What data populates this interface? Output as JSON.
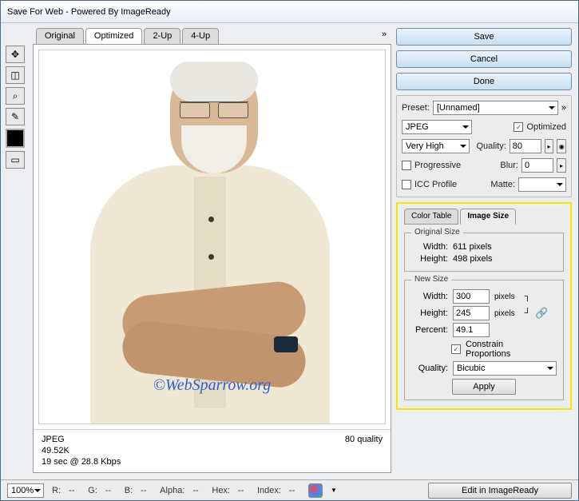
{
  "window": {
    "title": "Save For Web - Powered By ImageReady"
  },
  "tabs": {
    "original": "Original",
    "optimized": "Optimized",
    "two_up": "2-Up",
    "four_up": "4-Up"
  },
  "tools": {
    "hand": "✋",
    "slice": "✂",
    "zoom": "🔍",
    "eyedrop": "💧",
    "toggle": "⇆"
  },
  "info": {
    "format": "JPEG",
    "size": "49.52K",
    "speed": "19 sec @ 28.8 Kbps",
    "quality": "80 quality"
  },
  "watermark": "©WebSparrow.org",
  "buttons": {
    "save": "Save",
    "cancel": "Cancel",
    "done": "Done",
    "apply": "Apply",
    "edit": "Edit in ImageReady"
  },
  "settings": {
    "preset_label": "Preset:",
    "preset_value": "[Unnamed]",
    "format": "JPEG",
    "optimized_label": "Optimized",
    "optimized": "✓",
    "quality_preset": "Very High",
    "quality_label": "Quality:",
    "quality_value": "80",
    "progressive_label": "Progressive",
    "blur_label": "Blur:",
    "blur_value": "0",
    "icc_label": "ICC Profile",
    "matte_label": "Matte:"
  },
  "image_tabs": {
    "color_table": "Color Table",
    "image_size": "Image Size"
  },
  "original_size": {
    "legend": "Original Size",
    "width_label": "Width:",
    "width": "611 pixels",
    "height_label": "Height:",
    "height": "498 pixels"
  },
  "new_size": {
    "legend": "New Size",
    "width_label": "Width:",
    "width": "300",
    "height_label": "Height:",
    "height": "245",
    "unit": "pixels",
    "percent_label": "Percent:",
    "percent": "49.1",
    "constrain_label": "Constrain Proportions",
    "constrain": "✓",
    "quality_label": "Quality:",
    "quality": "Bicubic",
    "link": "🔗"
  },
  "status": {
    "zoom": "100%",
    "r": "R:",
    "g": "G:",
    "b": "B:",
    "alpha": "Alpha:",
    "hex": "Hex:",
    "index": "Index:",
    "dash": "--"
  }
}
